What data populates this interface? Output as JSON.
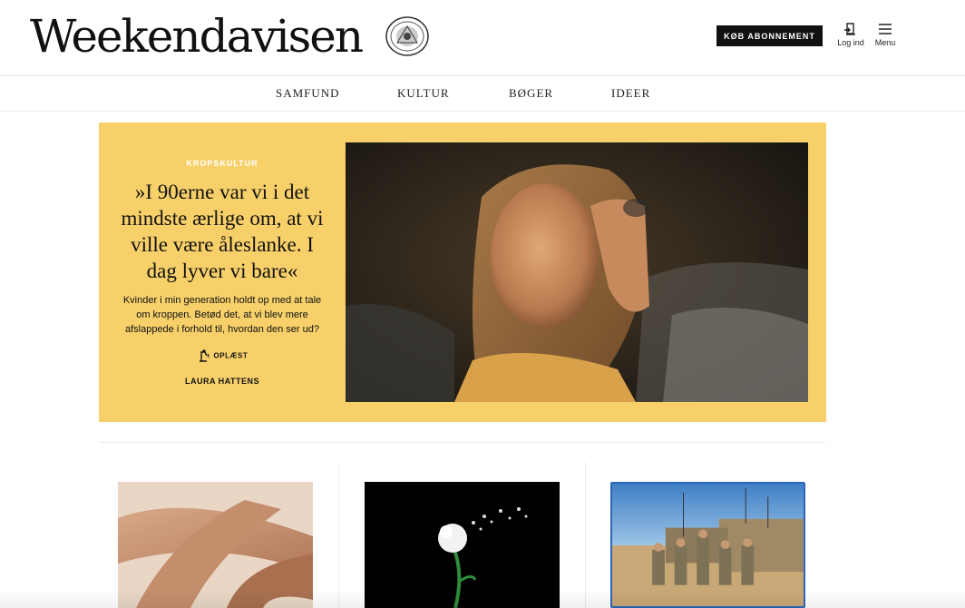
{
  "header": {
    "logo_text": "Weekendavisen",
    "buy_label": "KØB ABONNEMENT",
    "login_label": "Log ind",
    "menu_label": "Menu"
  },
  "nav": {
    "items": [
      "SAMFUND",
      "KULTUR",
      "BØGER",
      "IDEER"
    ]
  },
  "hero": {
    "kicker": "KROPSKULTUR",
    "headline": "»I 90erne var vi i det mindste ærlige om, at vi ville være åleslanke. I dag lyver vi bare«",
    "teaser": "Kvinder i min generation holdt op med at tale om kroppen. Betød det, at vi blev mere afslappede i forhold til, hvordan den ser ud?",
    "audio_label": "OPLÆST",
    "author": "LAURA HATTENS",
    "background_color": "#f7d06a"
  },
  "cards": [
    {
      "image": "intertwined-arms-photo"
    },
    {
      "image": "dandelion-on-black-photo"
    },
    {
      "image": "soldiers-in-desert-photo"
    }
  ],
  "colors": {
    "accent_black": "#111111",
    "hero_yellow": "#f7d06a",
    "selection_blue": "#2d66b9"
  }
}
